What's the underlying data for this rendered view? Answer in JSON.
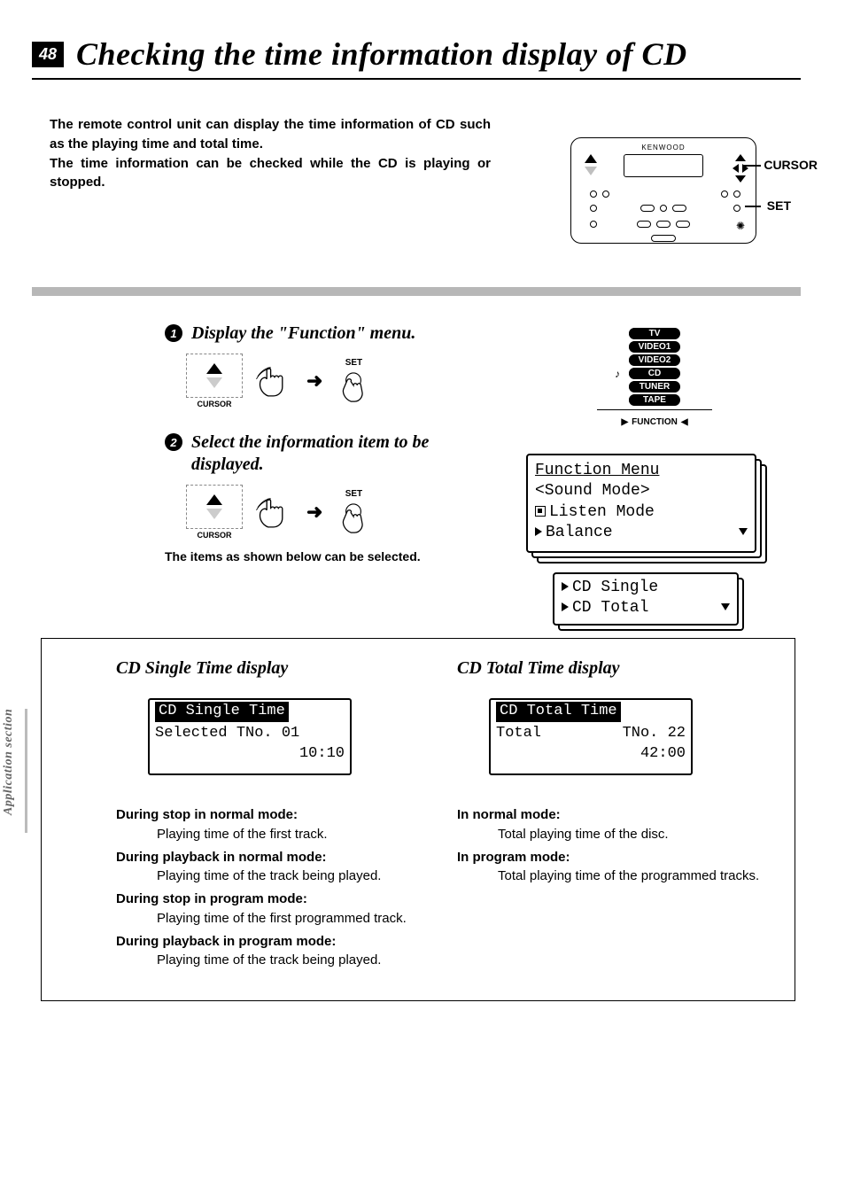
{
  "page_number": "48",
  "title": "Checking the time information display of CD",
  "sidebar": "Application section",
  "intro": "The remote control unit can display the time information of CD such as the playing time and total time.\nThe time information can be checked while the CD is playing or stopped.",
  "remote": {
    "brand": "KENWOOD",
    "label_cursor": "CURSOR",
    "label_set": "SET"
  },
  "step1": {
    "num": "1",
    "title": "Display the \"Function\" menu.",
    "cursor_label": "CURSOR",
    "set_label": "SET"
  },
  "step2": {
    "num": "2",
    "title": "Select the information item to be displayed.",
    "cursor_label": "CURSOR",
    "set_label": "SET",
    "note": "The items as shown below can be selected."
  },
  "function_stack": {
    "items": [
      "TV",
      "VIDEO1",
      "VIDEO2",
      "CD",
      "TUNER",
      "TAPE"
    ],
    "marker": "FUNCTION"
  },
  "lcd_menu": {
    "title": "Function Menu",
    "line1": "<Sound Mode>",
    "line2": "Listen Mode",
    "line3": "Balance",
    "sub1": "CD Single",
    "sub2": "CD Total"
  },
  "displays": {
    "single": {
      "heading": "CD Single Time display",
      "lcd_header": "CD Single Time",
      "lcd_line1": "Selected TNo. 01",
      "lcd_line2": "10:10",
      "defs": [
        {
          "h": "During stop in normal mode:",
          "p": "Playing time of the first track."
        },
        {
          "h": "During playback in normal mode:",
          "p": "Playing time of the track being played."
        },
        {
          "h": "During stop in program mode:",
          "p": "Playing time of the first programmed track."
        },
        {
          "h": "During playback in program mode:",
          "p": "Playing time of the track being played."
        }
      ]
    },
    "total": {
      "heading": "CD Total Time display",
      "lcd_header": "CD Total Time",
      "lcd_line1_l": "Total",
      "lcd_line1_r": "TNo. 22",
      "lcd_line2": "42:00",
      "defs": [
        {
          "h": "In normal mode:",
          "p": "Total playing time of the disc."
        },
        {
          "h": "In program mode:",
          "p": "Total playing time of the programmed tracks."
        }
      ]
    }
  }
}
